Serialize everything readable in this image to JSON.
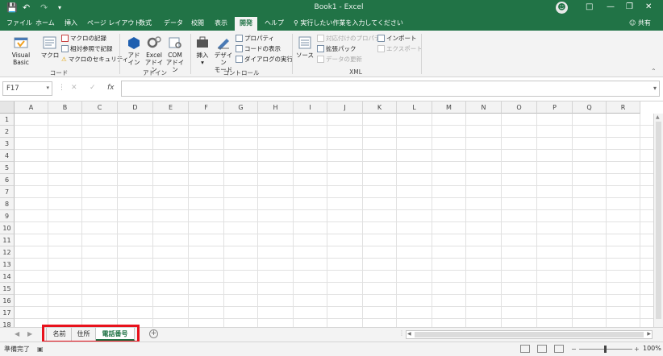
{
  "title": "Book1 - Excel",
  "qat": {
    "save_icon": "save-icon",
    "undo_icon": "undo-icon",
    "redo_icon": "redo-icon",
    "customize_icon": "customize-qat-icon"
  },
  "tabs": [
    "ファイル",
    "ホーム",
    "挿入",
    "ページ レイアウト",
    "数式",
    "データ",
    "校閲",
    "表示",
    "開発",
    "ヘルプ"
  ],
  "active_tab": "開発",
  "tell_me": "実行したい作業を入力してください",
  "share": "共有",
  "ribbon": {
    "code": {
      "label": "コード",
      "visual_basic": "Visual Basic",
      "macros": "マクロ",
      "record": "マクロの記録",
      "relative": "相対参照で記録",
      "security": "マクロのセキュリティ"
    },
    "addins": {
      "label": "アドイン",
      "addin_1": "アド",
      "addin_2": "イン",
      "excel_1": "Excel",
      "excel_2": "アドイン",
      "com_1": "COM",
      "com_2": "アドイン"
    },
    "controls": {
      "label": "コントロール",
      "insert": "挿入",
      "design_1": "デザイン",
      "design_2": "モード",
      "properties": "プロパティ",
      "view_code": "コードの表示",
      "run_dialog": "ダイアログの実行"
    },
    "xml": {
      "label": "XML",
      "source": "ソース",
      "map_props": "対応付けのプロパティ",
      "expansion": "拡張パック",
      "refresh": "データの更新",
      "import": "インポート",
      "export": "エクスポート"
    }
  },
  "formula_bar": {
    "name_box": "F17",
    "fx": "fx",
    "value": ""
  },
  "columns": [
    "A",
    "B",
    "C",
    "D",
    "E",
    "F",
    "G",
    "H",
    "I",
    "J",
    "K",
    "L",
    "M",
    "N",
    "O",
    "P",
    "Q",
    "R"
  ],
  "rows": [
    "1",
    "2",
    "3",
    "4",
    "5",
    "6",
    "7",
    "8",
    "9",
    "10",
    "11",
    "12",
    "13",
    "14",
    "15",
    "16",
    "17",
    "18"
  ],
  "sheets": [
    "名前",
    "住所",
    "電話番号"
  ],
  "active_sheet": "電話番号",
  "status": {
    "ready": "準備完了",
    "zoom": "100%"
  },
  "colors": {
    "accent": "#217346",
    "highlight": "#e8121c"
  }
}
